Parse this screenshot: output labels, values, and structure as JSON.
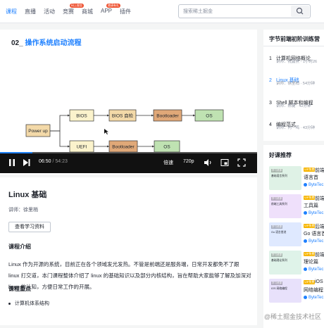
{
  "nav": {
    "items": [
      {
        "label": "课程",
        "active": true
      },
      {
        "label": "直播"
      },
      {
        "label": "活动"
      },
      {
        "label": "竞赛",
        "badge": "码上掘金"
      },
      {
        "label": "商城"
      },
      {
        "label": "APP",
        "badge": "邀请有礼"
      },
      {
        "label": "插件"
      }
    ],
    "search_placeholder": "搜索稀土掘金",
    "search_icon": "search-icon"
  },
  "video": {
    "title_num": "02_",
    "title_text": "操作系统启动流程",
    "diagram": {
      "power_on": "Power up",
      "bios": "BIOS",
      "bios_self": "BIOS 自检",
      "bootloader1": "Bootloader",
      "os1": "OS",
      "uefi": "UEFI",
      "bootloader2": "Bootloader",
      "os2": "OS"
    },
    "controls": {
      "time_current": "06:50",
      "time_sep": " / ",
      "time_total": "54:23",
      "speed": "倍速",
      "quality": "720p",
      "progress": 0.125,
      "play_icon": "play-pause-icon",
      "next_icon": "next-icon",
      "volume_icon": "volume-icon",
      "pip_icon": "picture-in-picture-icon",
      "fullscreen_icon": "fullscreen-icon"
    }
  },
  "course": {
    "title": "Linux 基础",
    "teacher": "讲师：徐里梢",
    "materials_button": "查看学习资料",
    "intro_heading": "课程介绍",
    "intro_text": "Linux 作为开源的系统，目前正在各个领域发光发热。不管是前端还是服务端，日常开发都免不了跟 linux 打交道，本门课程整体介绍了 linux 的基础知识以及部分内核结构，旨在帮助大家能够了解及加深对 linux 的认知，方便日常工作的开展。",
    "points_heading": "课程重点",
    "points": [
      "计算机体系结构"
    ]
  },
  "chapters": {
    "title": "字节前端初阶训练营",
    "items": [
      {
        "num": "1",
        "name": "计算机网络概论",
        "meta": "讲师：祝鑫焘 · 1小时26"
      },
      {
        "num": "2",
        "name": "Linux 基础",
        "meta": "讲师：徐里梢 · 54分钟",
        "active": true
      },
      {
        "num": "3",
        "name": "Shell 脚本和编程",
        "meta": "讲师：陈健 · 42分钟"
      },
      {
        "num": "4",
        "name": "编程范式",
        "meta": "讲师：何一鸣 · 43分钟"
      }
    ]
  },
  "recommend": {
    "title": "好课推荐",
    "items": [
      {
        "thumb_tag": "学习资源",
        "thumb_text": "基础语言系列",
        "vip": "VIP免费",
        "name1": "前端",
        "name2": "语言首",
        "author": "ByteTec",
        "color": "#dff2e6"
      },
      {
        "thumb_tag": "学习资源",
        "thumb_text": "前端工具系列",
        "vip": "VIP免费",
        "name1": "前端",
        "name2": "工具篇",
        "author": "ByteTec",
        "color": "#efe0fb"
      },
      {
        "thumb_tag": "学习资源",
        "thumb_text": "Go 语言首进",
        "vip": "VIP免费",
        "name1": "后端",
        "name2": "Go 语言首",
        "author": "ByteTec",
        "color": "#dfe9ff"
      },
      {
        "thumb_tag": "学习资源",
        "thumb_text": "基础理论系列",
        "vip": "VIP免费",
        "name1": "前端",
        "name2": "理论篇",
        "author": "ByteTec",
        "color": "#dff3e9"
      },
      {
        "thumb_tag": "学习资源",
        "thumb_text": "IOS 网络编程",
        "vip": "VIP免费",
        "name1": "iOS",
        "name2": "网络编程",
        "author": "ByteTec",
        "color": "#e8e1fb"
      }
    ]
  },
  "watermark": "@稀土掘金技术社区"
}
